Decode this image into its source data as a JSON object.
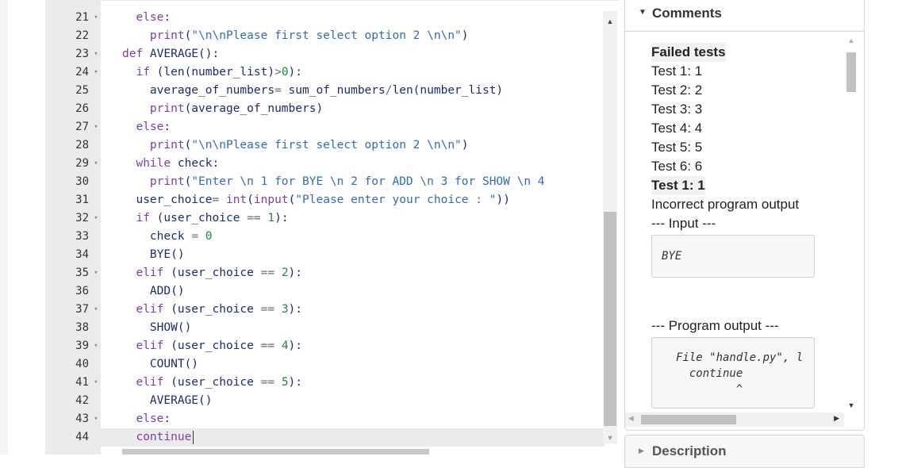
{
  "editor": {
    "lines": [
      {
        "n": "21",
        "fold": "▾",
        "tokens": [
          {
            "t": "  "
          },
          {
            "t": "else",
            "c": "kw"
          },
          {
            "t": ":"
          }
        ]
      },
      {
        "n": "22",
        "fold": "",
        "tokens": [
          {
            "t": "    "
          },
          {
            "t": "print",
            "c": "kw"
          },
          {
            "t": "("
          },
          {
            "t": "\"\\n\\nPlease first select option 2 \\n\\n\"",
            "c": "str"
          },
          {
            "t": ")"
          }
        ]
      },
      {
        "n": "23",
        "fold": "▾",
        "tokens": [
          {
            "t": "def",
            "c": "kw"
          },
          {
            "t": " AVERAGE():"
          }
        ]
      },
      {
        "n": "24",
        "fold": "▾",
        "tokens": [
          {
            "t": "  "
          },
          {
            "t": "if",
            "c": "kw"
          },
          {
            "t": " (len(number_list)"
          },
          {
            "t": ">",
            "c": "op"
          },
          {
            "t": "0",
            "c": "num"
          },
          {
            "t": "):"
          }
        ]
      },
      {
        "n": "25",
        "fold": "",
        "tokens": [
          {
            "t": "    average_of_numbers"
          },
          {
            "t": "=",
            "c": "op"
          },
          {
            "t": " sum_of_numbers"
          },
          {
            "t": "/",
            "c": "op"
          },
          {
            "t": "len(number_list)"
          }
        ]
      },
      {
        "n": "26",
        "fold": "",
        "tokens": [
          {
            "t": "    "
          },
          {
            "t": "print",
            "c": "kw"
          },
          {
            "t": "(average_of_numbers)"
          }
        ]
      },
      {
        "n": "27",
        "fold": "▾",
        "tokens": [
          {
            "t": "  "
          },
          {
            "t": "else",
            "c": "kw"
          },
          {
            "t": ":"
          }
        ]
      },
      {
        "n": "28",
        "fold": "",
        "tokens": [
          {
            "t": "    "
          },
          {
            "t": "print",
            "c": "kw"
          },
          {
            "t": "("
          },
          {
            "t": "\"\\n\\nPlease first select option 2 \\n\\n\"",
            "c": "str"
          },
          {
            "t": ")"
          }
        ]
      },
      {
        "n": "29",
        "fold": "▾",
        "tokens": [
          {
            "t": "  "
          },
          {
            "t": "while",
            "c": "kw"
          },
          {
            "t": " check:"
          }
        ]
      },
      {
        "n": "30",
        "fold": "",
        "tokens": [
          {
            "t": "    "
          },
          {
            "t": "print",
            "c": "kw"
          },
          {
            "t": "("
          },
          {
            "t": "\"Enter \\n 1 for BYE \\n 2 for ADD \\n 3 for SHOW \\n 4 ",
            "c": "str"
          }
        ]
      },
      {
        "n": "31",
        "fold": "",
        "tokens": [
          {
            "t": "  user_choice"
          },
          {
            "t": "=",
            "c": "op"
          },
          {
            "t": " "
          },
          {
            "t": "int",
            "c": "kw"
          },
          {
            "t": "("
          },
          {
            "t": "input",
            "c": "kw"
          },
          {
            "t": "("
          },
          {
            "t": "\"Please enter your choice : \"",
            "c": "str"
          },
          {
            "t": "))"
          }
        ]
      },
      {
        "n": "32",
        "fold": "▾",
        "tokens": [
          {
            "t": "  "
          },
          {
            "t": "if",
            "c": "kw"
          },
          {
            "t": " (user_choice "
          },
          {
            "t": "==",
            "c": "op"
          },
          {
            "t": " "
          },
          {
            "t": "1",
            "c": "num"
          },
          {
            "t": "):"
          }
        ]
      },
      {
        "n": "33",
        "fold": "",
        "tokens": [
          {
            "t": "    check "
          },
          {
            "t": "=",
            "c": "op"
          },
          {
            "t": " "
          },
          {
            "t": "0",
            "c": "num"
          }
        ]
      },
      {
        "n": "34",
        "fold": "",
        "tokens": [
          {
            "t": "    BYE()"
          }
        ]
      },
      {
        "n": "35",
        "fold": "▾",
        "tokens": [
          {
            "t": "  "
          },
          {
            "t": "elif",
            "c": "kw"
          },
          {
            "t": " (user_choice "
          },
          {
            "t": "==",
            "c": "op"
          },
          {
            "t": " "
          },
          {
            "t": "2",
            "c": "num"
          },
          {
            "t": "):"
          }
        ]
      },
      {
        "n": "36",
        "fold": "",
        "tokens": [
          {
            "t": "    ADD()"
          }
        ]
      },
      {
        "n": "37",
        "fold": "▾",
        "tokens": [
          {
            "t": "  "
          },
          {
            "t": "elif",
            "c": "kw"
          },
          {
            "t": " (user_choice "
          },
          {
            "t": "==",
            "c": "op"
          },
          {
            "t": " "
          },
          {
            "t": "3",
            "c": "num"
          },
          {
            "t": "):"
          }
        ]
      },
      {
        "n": "38",
        "fold": "",
        "tokens": [
          {
            "t": "    SHOW()"
          }
        ]
      },
      {
        "n": "39",
        "fold": "▾",
        "tokens": [
          {
            "t": "  "
          },
          {
            "t": "elif",
            "c": "kw"
          },
          {
            "t": " (user_choice "
          },
          {
            "t": "==",
            "c": "op"
          },
          {
            "t": " "
          },
          {
            "t": "4",
            "c": "num"
          },
          {
            "t": "):"
          }
        ]
      },
      {
        "n": "40",
        "fold": "",
        "tokens": [
          {
            "t": "    COUNT()"
          }
        ]
      },
      {
        "n": "41",
        "fold": "▾",
        "tokens": [
          {
            "t": "  "
          },
          {
            "t": "elif",
            "c": "kw"
          },
          {
            "t": " (user_choice "
          },
          {
            "t": "==",
            "c": "op"
          },
          {
            "t": " "
          },
          {
            "t": "5",
            "c": "num"
          },
          {
            "t": "):"
          }
        ]
      },
      {
        "n": "42",
        "fold": "",
        "tokens": [
          {
            "t": "    AVERAGE()"
          }
        ]
      },
      {
        "n": "43",
        "fold": "▾",
        "tokens": [
          {
            "t": "  "
          },
          {
            "t": "else",
            "c": "kw"
          },
          {
            "t": ":"
          }
        ]
      },
      {
        "n": "44",
        "fold": "",
        "active": true,
        "tokens": [
          {
            "t": "  "
          },
          {
            "t": "continue",
            "c": "kw"
          }
        ]
      }
    ]
  },
  "comments": {
    "title": "Comments",
    "failed_tests_heading": "Failed tests",
    "tests": [
      "Test 1: 1",
      "Test 2: 2",
      "Test 3: 3",
      "Test 4: 4",
      "Test 5: 5",
      "Test 6: 6"
    ],
    "detail_heading": "Test 1: 1",
    "detail_message": "Incorrect program output",
    "input_label": "--- Input ---",
    "input_value": "BYE",
    "output_label": "--- Program output ---",
    "output_text": "File \"handle.py\", l\n  continue\n         ^"
  },
  "description": {
    "title": "Description"
  },
  "colors": {
    "keyword": "#7a3ea8",
    "string": "#2f6db6",
    "number": "#1a8a3a",
    "gutter": "#ebebeb"
  }
}
